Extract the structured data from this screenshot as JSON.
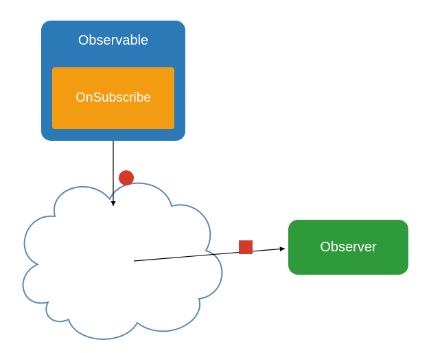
{
  "observable": {
    "label": "Observable"
  },
  "onsubscribe": {
    "label": "OnSubscribe"
  },
  "observer": {
    "label": "Observer"
  },
  "colors": {
    "observable_bg": "#2c79b8",
    "onsubscribe_bg": "#f39c12",
    "observer_bg": "#2e9a3a",
    "marker": "#d33a27",
    "cloud_stroke": "#5b8bb8"
  },
  "arrows": {
    "down": {
      "from": "OnSubscribe",
      "to": "cloud"
    },
    "right": {
      "from": "cloud",
      "to": "Observer"
    }
  },
  "markers": {
    "circle": {
      "shape": "circle",
      "meaning": "event-on-downstream"
    },
    "square": {
      "shape": "square",
      "meaning": "event-to-observer"
    }
  }
}
